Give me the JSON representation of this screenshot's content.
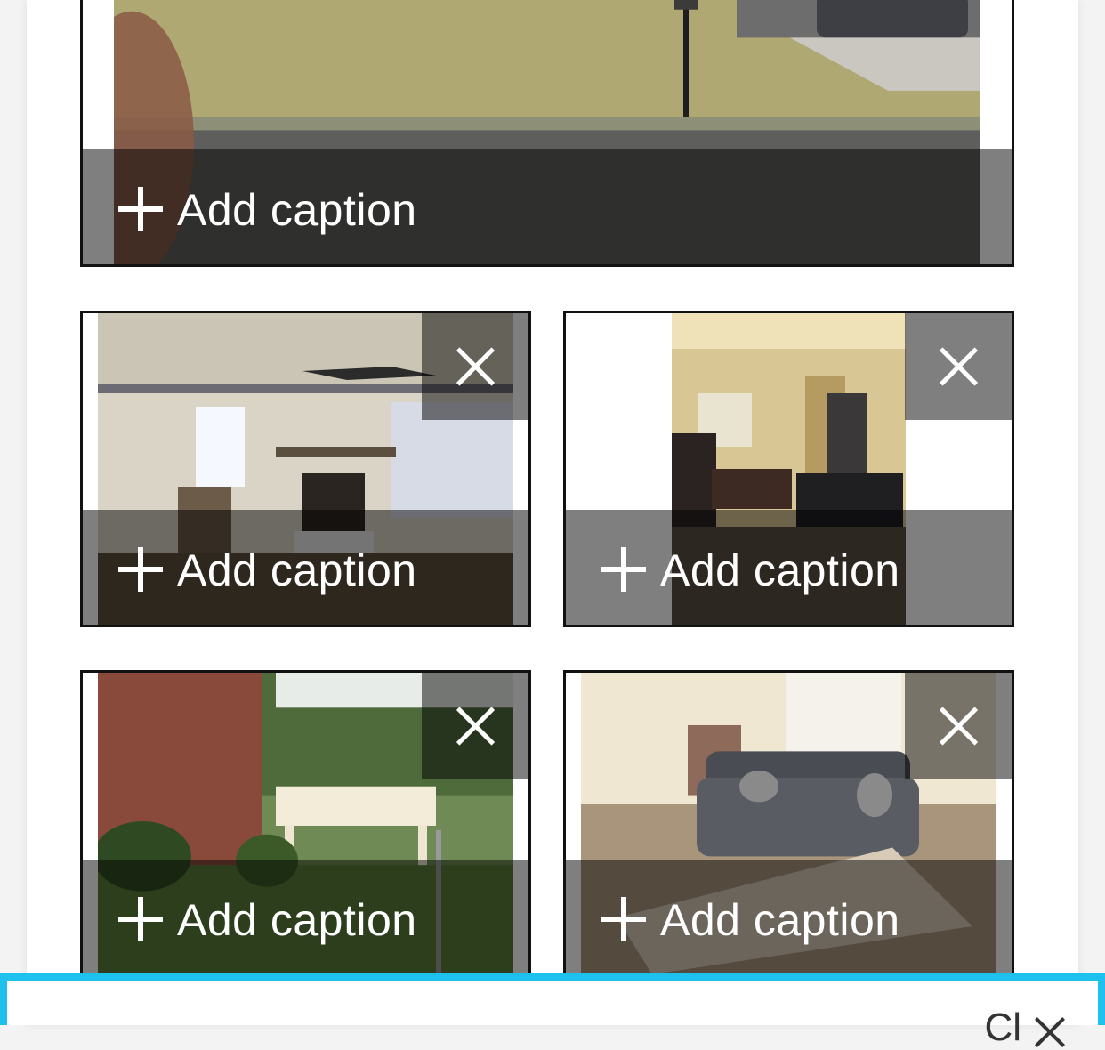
{
  "photos": [
    {
      "caption_action": "Add caption",
      "scene": "front yard with mailbox and street",
      "removable": false
    },
    {
      "caption_action": "Add caption",
      "scene": "living room with fireplace and ceiling fan",
      "removable": true
    },
    {
      "caption_action": "Add caption",
      "scene": "bedroom with dresser and vanity mirror",
      "removable": true
    },
    {
      "caption_action": "Add caption",
      "scene": "back yard with deck and brick wall",
      "removable": true
    },
    {
      "caption_action": "Add caption",
      "scene": "living room with gray sofa and rug",
      "removable": true
    }
  ],
  "bottom_bar": {
    "close_label": "Cl"
  },
  "colors": {
    "accent": "#1ec0ee",
    "overlay": "rgba(0,0,0,0.5)"
  }
}
